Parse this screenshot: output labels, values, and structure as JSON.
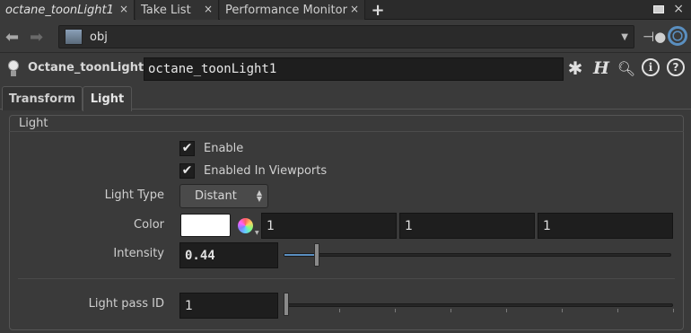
{
  "tabs": [
    {
      "label": "octane_toonLight1",
      "active": true
    },
    {
      "label": "Take List",
      "active": false
    },
    {
      "label": "Performance Monitor",
      "active": false
    }
  ],
  "tab_close_glyph": "×",
  "path": {
    "value": "obj"
  },
  "node": {
    "type": "Octane_toonLight",
    "name": "octane_toonLight1"
  },
  "param_tabs": [
    {
      "label": "Transform",
      "active": false
    },
    {
      "label": "Light",
      "active": true
    }
  ],
  "folder": {
    "title": "Light"
  },
  "params": {
    "enable_label": "Enable",
    "enable_checked": true,
    "enabled_viewports_label": "Enabled In Viewports",
    "enabled_viewports_checked": true,
    "light_type_label": "Light Type",
    "light_type_value": "Distant",
    "color_label": "Color",
    "color_swatch": "#ffffff",
    "color_r": "1",
    "color_g": "1",
    "color_b": "1",
    "intensity_label": "Intensity",
    "intensity_value": "0.44",
    "intensity_fraction": 0.044,
    "pass_id_label": "Light pass ID",
    "pass_id_value": "1",
    "pass_id_fraction": 0.0
  },
  "icons": {
    "back": "back-arrow-icon",
    "forward": "forward-arrow-icon",
    "network": "network-icon",
    "pin": "pin-icon",
    "link": "link-icon",
    "light": "light-bulb-icon",
    "gear": "gear-icon",
    "hscript": "hscript-icon",
    "search": "search-icon",
    "info": "info-icon",
    "help": "help-icon",
    "color_wheel": "color-wheel-icon"
  },
  "colors": {
    "accent": "#5a8fc0",
    "background": "#3a3a3a",
    "field": "#1e1e1e"
  }
}
